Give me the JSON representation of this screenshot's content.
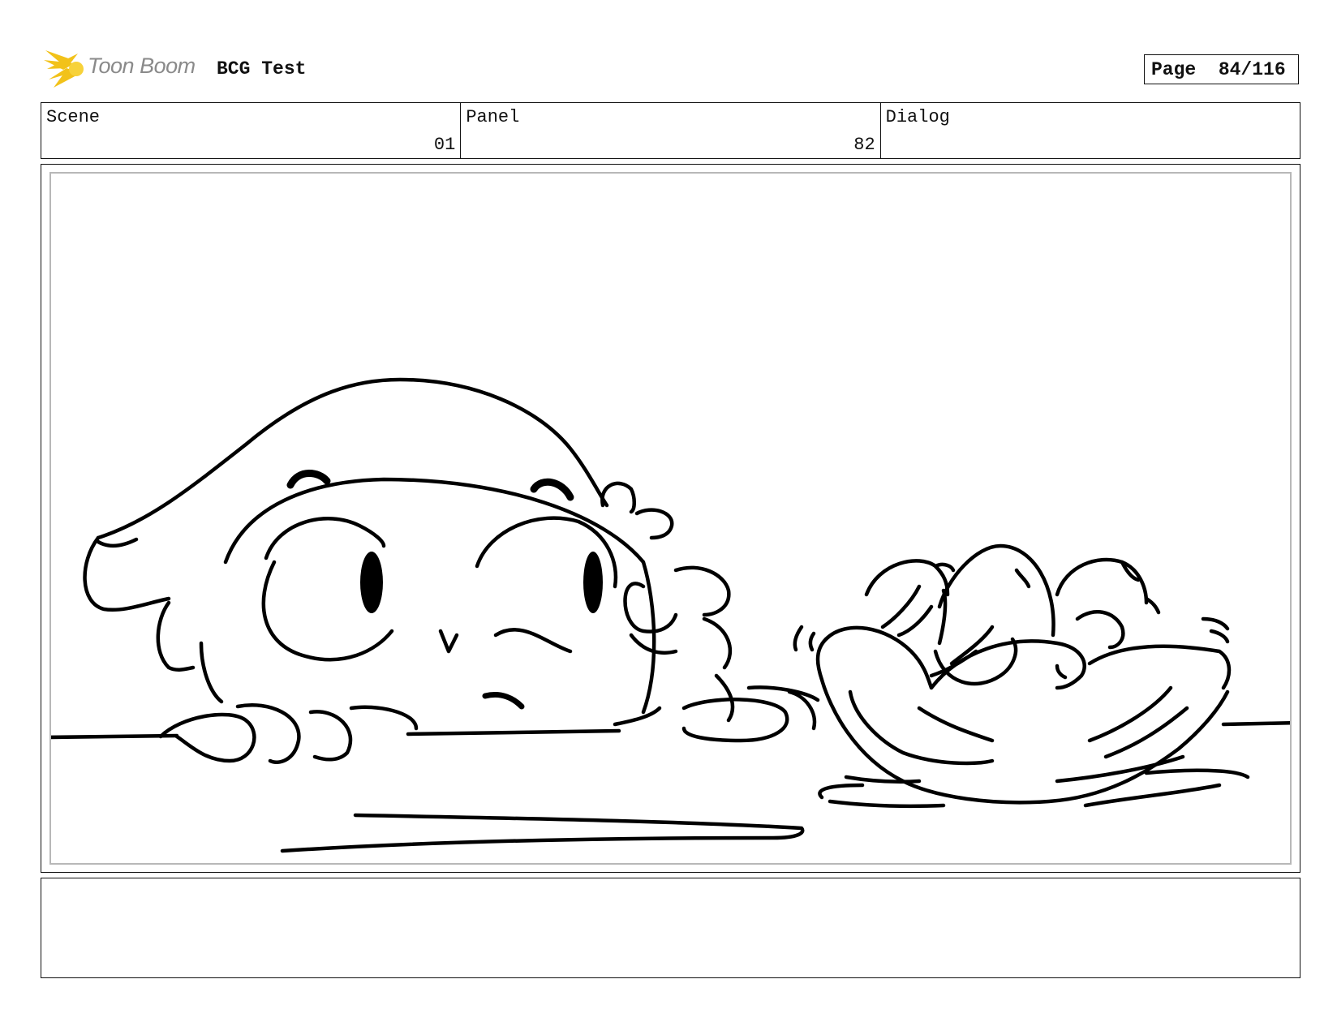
{
  "header": {
    "logo_text": "Toon Boom",
    "project_title": "BCG Test",
    "page_label": "Page",
    "page_number": "84/116"
  },
  "fields": {
    "scene_label": "Scene",
    "scene_value": "01",
    "panel_label": "Panel",
    "panel_value": "82",
    "dialog_label": "Dialog",
    "dialog_value": ""
  },
  "notes": "",
  "colors": {
    "logo_accent": "#f2c21a",
    "logo_text": "#8a8a8a",
    "frame_border": "#111111",
    "panel_inner_border": "#b8b8b8"
  }
}
